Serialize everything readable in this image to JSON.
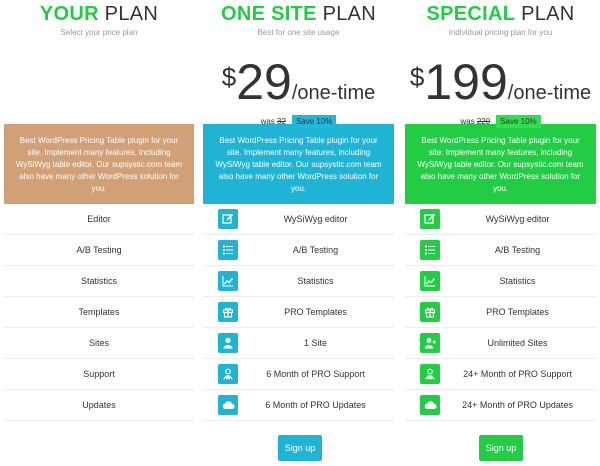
{
  "colors": {
    "green": "#22cc44",
    "cyan": "#1fb3d4",
    "tan": "#d1a077",
    "badge_cyan": "#20b9dd",
    "badge_green": "#2ee04d"
  },
  "plans": [
    {
      "title_highlight": "YOUR",
      "title_rest": " PLAN",
      "subtitle": "Select your price plan",
      "description": "Best WordPress Pricing Table plugin for your site. Implement many features, including WySiWyg table editor. Our supsystic.com team also have many other WordPress solution for you.",
      "features": [
        "Editor",
        "A/B Testing",
        "Statistics",
        "Templates",
        "Sites",
        "Support",
        "Updates"
      ]
    },
    {
      "title_highlight": "ONE SITE",
      "title_rest": " PLAN",
      "subtitle": "Best for one site usage",
      "currency": "$",
      "amount": "29",
      "period": "/one-time",
      "was_label": "was",
      "was_price": "32",
      "save_label": "Save 10%",
      "description": "Best WordPress Pricing Table plugin for your site. Implement many features, including WySiWyg table editor. Our supsystic.com team also have many other WordPress solution for you.",
      "features": [
        {
          "icon": "edit-icon",
          "text": "WySiWyg editor"
        },
        {
          "icon": "list-icon",
          "text": "A/B Testing"
        },
        {
          "icon": "chart-icon",
          "text": "Statistics"
        },
        {
          "icon": "gift-icon",
          "text": "PRO Templates"
        },
        {
          "icon": "user-icon",
          "text": "1 Site"
        },
        {
          "icon": "support-icon",
          "text": "6 Month of PRO Support"
        },
        {
          "icon": "cloud-icon",
          "text": "6 Month of PRO Updates"
        }
      ],
      "signup_label": "Sign up"
    },
    {
      "title_highlight": "SPECIAL",
      "title_rest": " PLAN",
      "subtitle": "Individual pricing plan for you",
      "currency": "$",
      "amount": "199",
      "period": "/one-time",
      "was_label": "was",
      "was_price": "220",
      "save_label": "Save 10%",
      "description": "Best WordPress Pricing Table plugin for your site. Implement many features, including WySiWyg table editor. Our supsystic.com team also have many other WordPress solution for you.",
      "features": [
        {
          "icon": "edit-icon",
          "text": "WySiWyg editor"
        },
        {
          "icon": "list-icon",
          "text": "A/B Testing"
        },
        {
          "icon": "chart-icon",
          "text": "Statistics"
        },
        {
          "icon": "gift-icon",
          "text": "PRO Templates"
        },
        {
          "icon": "user-plus-icon",
          "text": "Unlimited Sites"
        },
        {
          "icon": "support-icon",
          "text": "24+ Month of PRO Support"
        },
        {
          "icon": "cloud-icon",
          "text": "24+ Month of PRO Updates"
        }
      ],
      "signup_label": "Sign up"
    }
  ]
}
